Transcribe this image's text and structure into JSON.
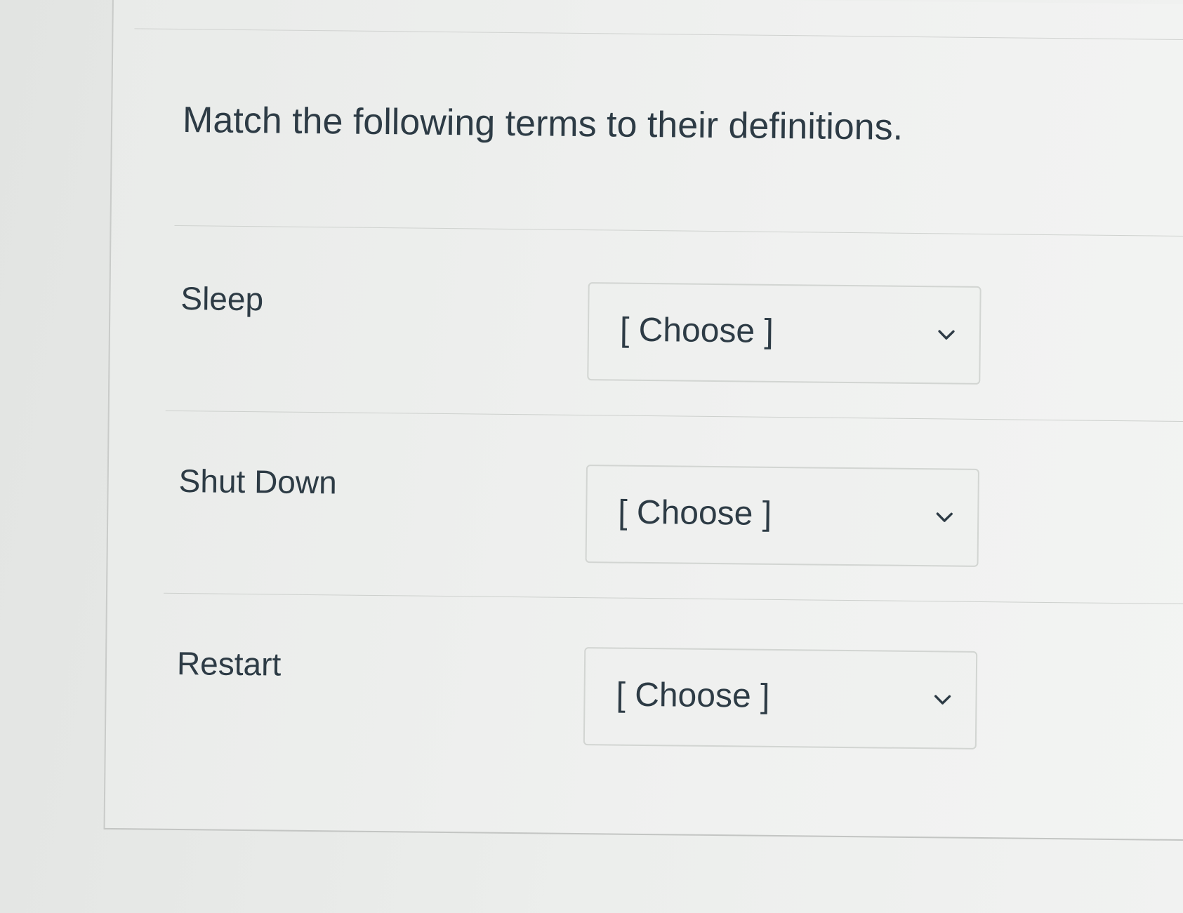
{
  "question": {
    "prompt": "Match the following terms to their definitions."
  },
  "matches": [
    {
      "term": "Sleep",
      "selected": "[ Choose ]",
      "icon": "chevron-down-icon"
    },
    {
      "term": "Shut Down",
      "selected": "[ Choose ]",
      "icon": "chevron-down-icon"
    },
    {
      "term": "Restart",
      "selected": "[ Choose ]",
      "icon": "chevron-down-icon"
    }
  ],
  "colors": {
    "text": "#2d3b45",
    "border": "#d2d5d2"
  }
}
